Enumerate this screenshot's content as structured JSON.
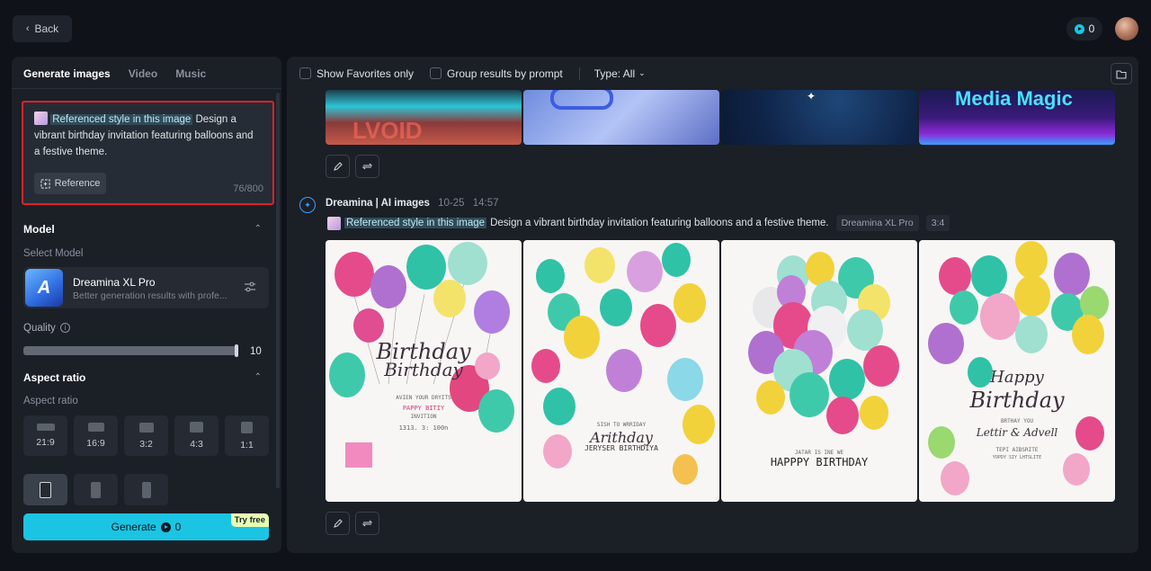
{
  "topbar": {
    "back_label": "Back",
    "credits": "0"
  },
  "left": {
    "tabs": [
      "Generate images",
      "Video",
      "Music"
    ],
    "prompt": {
      "ref_label": "Referenced style in this image",
      "text": "Design a vibrant birthday invitation featuring balloons and a festive theme.",
      "reference_btn": "Reference",
      "counter": "76/800"
    },
    "model": {
      "section": "Model",
      "select_label": "Select Model",
      "name": "Dreamina XL Pro",
      "description": "Better generation results with profe..."
    },
    "quality": {
      "label": "Quality",
      "value": "10",
      "level": 1.0
    },
    "aspect": {
      "section": "Aspect ratio",
      "label": "Aspect ratio",
      "options": [
        "21:9",
        "16:9",
        "3:2",
        "4:3",
        "1:1"
      ]
    },
    "generate": {
      "label": "Generate",
      "credits": "0",
      "badge": "Try free"
    }
  },
  "right": {
    "filters": {
      "favorites": "Show Favorites only",
      "group": "Group results by prompt",
      "type": "Type: All"
    },
    "top_row_texts": [
      "Media Magic"
    ],
    "result": {
      "source": "Dreamina | AI images",
      "date": "10-25",
      "time": "14:57",
      "ref_label": "Referenced style in this image",
      "prompt": "Design a vibrant birthday invitation featuring balloons and a festive theme.",
      "model": "Dreamina XL Pro",
      "ratio": "3:4"
    },
    "cards": [
      {
        "title1": "Birthday",
        "title2": "Birthday",
        "line1": "AVIEN YOUR DRYITS",
        "line2": "PAPPY BITIY",
        "line3": "INVITION",
        "line4": "1313. 3: 100n"
      },
      {
        "title1": "Arithday",
        "title2": "JERYSER BIRTHDIYA",
        "line1": "SISH TO WRRIDAY",
        "line2": "",
        "line3": "",
        "line4": ""
      },
      {
        "title1": "JATAR IS INE WE",
        "title2": "HAPPPY BIRTHDAY",
        "line1": "",
        "line2": "",
        "line3": "",
        "line4": ""
      },
      {
        "title1": "Happy",
        "title2": "Birthday",
        "line1": "BRTHAY YOU",
        "line2": "Lettir & Advell",
        "line3": "TEPI AIBSRITE",
        "line4": "YOPDY SIY LHTSLITE"
      }
    ]
  },
  "colors": {
    "accent": "#1cc4e3",
    "highlight_border": "#e0222a",
    "panel": "#1b1f26",
    "background": "#0f1319"
  }
}
